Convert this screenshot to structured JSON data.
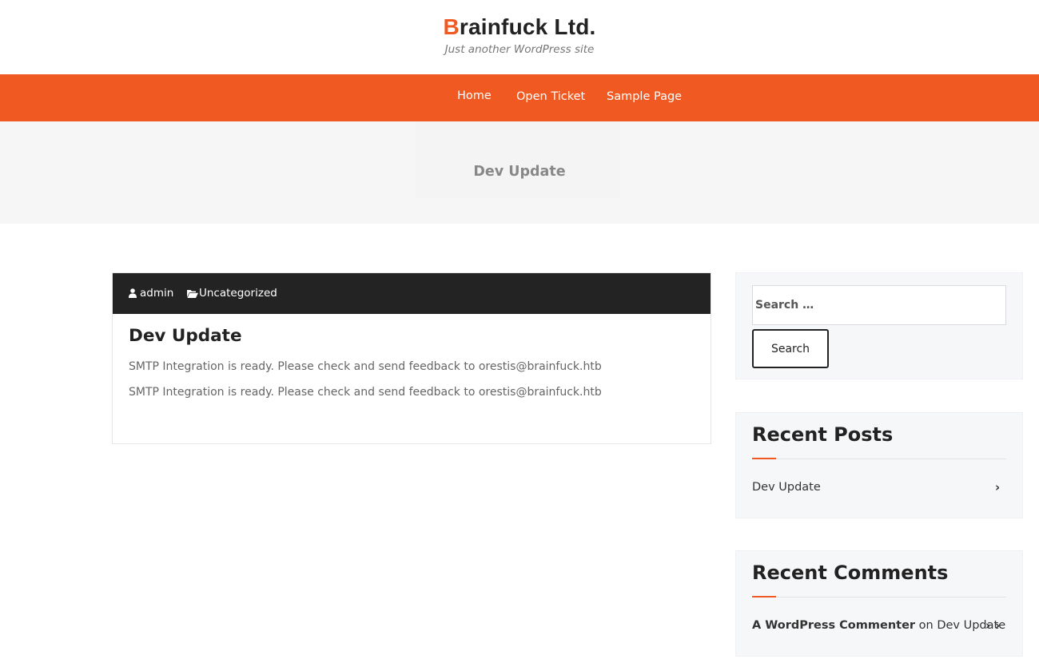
{
  "site": {
    "title_first_letter": "B",
    "title_rest": "rainfuck Ltd.",
    "tagline": "Just another WordPress site",
    "accent_color": "#f05a22"
  },
  "nav": {
    "items": [
      {
        "label": "Home"
      },
      {
        "label": "Open Ticket"
      },
      {
        "label": "Sample Page"
      }
    ]
  },
  "banner": {
    "title": "Dev Update"
  },
  "post": {
    "author": "admin",
    "author_icon": "user-icon",
    "category": "Uncategorized",
    "category_icon": "folder-open-icon",
    "title": "Dev Update",
    "lines": [
      "SMTP Integration is ready. Please check and send feedback to orestis@brainfuck.htb",
      "SMTP Integration is ready. Please check and send feedback to orestis@brainfuck.htb"
    ]
  },
  "sidebar": {
    "search": {
      "placeholder": "Search …",
      "button_label": "Search"
    },
    "recent_posts": {
      "title": "Recent Posts",
      "items": [
        {
          "label": "Dev Update",
          "icon": "chevron-right-icon"
        }
      ]
    },
    "recent_comments": {
      "title": "Recent Comments",
      "items": [
        {
          "author": "A WordPress Commenter",
          "on": "on",
          "post": "Dev Update",
          "icon": "chevron-right-icon"
        }
      ]
    }
  }
}
